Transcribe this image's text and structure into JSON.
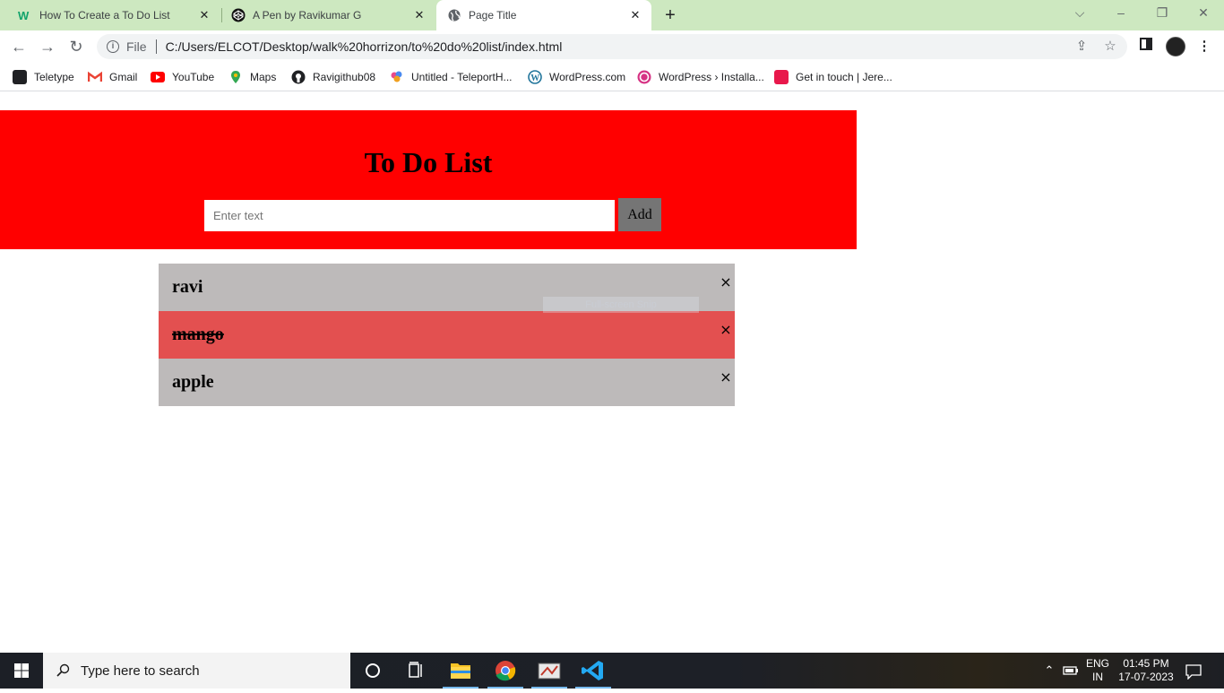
{
  "browser": {
    "tabs": [
      {
        "title": "How To Create a To Do List",
        "icon": "wix-icon",
        "active": false
      },
      {
        "title": "A Pen by Ravikumar G",
        "icon": "codepen-icon",
        "active": false
      },
      {
        "title": "Page Title",
        "icon": "globe-icon",
        "active": true
      }
    ],
    "address": {
      "scheme_label": "File",
      "url": "C:/Users/ELCOT/Desktop/walk%20horrizon/to%20do%20list/index.html"
    },
    "bookmarks": [
      {
        "label": "Teletype",
        "icon": "teletype-icon",
        "color": "#202124"
      },
      {
        "label": "Gmail",
        "icon": "gmail-icon",
        "color": "#ea4335"
      },
      {
        "label": "YouTube",
        "icon": "youtube-icon",
        "color": "#ff0000"
      },
      {
        "label": "Maps",
        "icon": "maps-icon",
        "color": "#34a853"
      },
      {
        "label": "Ravigithub08",
        "icon": "github-icon",
        "color": "#202124"
      },
      {
        "label": "Untitled - TeleportH...",
        "icon": "teleporthq-icon",
        "color": "#e94a8a"
      },
      {
        "label": "WordPress.com",
        "icon": "wordpress-icon",
        "color": "#21759b"
      },
      {
        "label": "WordPress › Installa...",
        "icon": "wordpress-install-icon",
        "color": "#d63384"
      },
      {
        "label": "Get in touch | Jere...",
        "icon": "jere-icon",
        "color": "#e8184b"
      }
    ]
  },
  "page": {
    "title": "To Do List",
    "input_placeholder": "Enter text",
    "add_label": "Add",
    "items": [
      {
        "text": "ravi",
        "checked": false
      },
      {
        "text": "mango",
        "checked": true
      },
      {
        "text": "apple",
        "checked": false
      }
    ],
    "close_glyph": "×",
    "overlay_text": "Full-screen Snip",
    "colors": {
      "header": "#ff0000",
      "item": "#bdbaba",
      "checked_item": "#e35050",
      "add_button": "#757575"
    }
  },
  "taskbar": {
    "search_placeholder": "Type here to search",
    "lang_top": "ENG",
    "lang_bottom": "IN",
    "time": "01:45 PM",
    "date": "17-07-2023"
  }
}
